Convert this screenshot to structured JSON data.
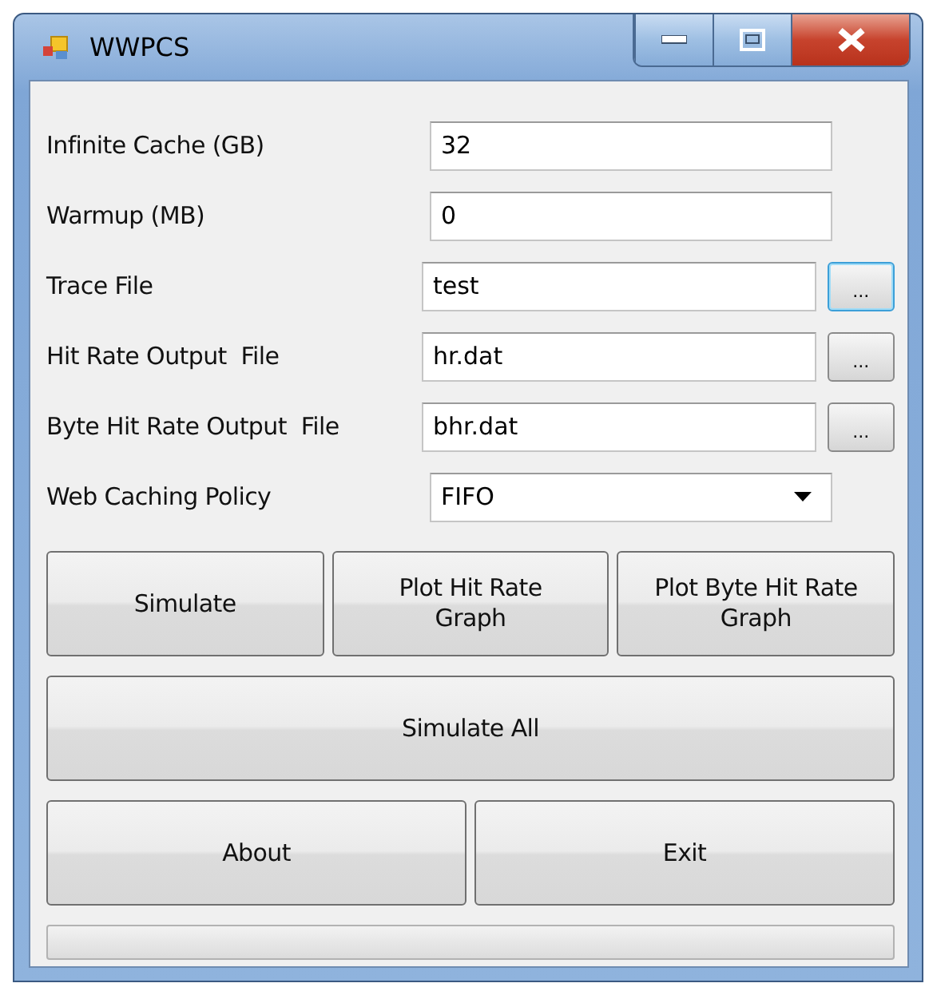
{
  "window": {
    "title": "WWPCS"
  },
  "fields": [
    {
      "kind": "text",
      "label": "Infinite Cache (GB)",
      "value": "32"
    },
    {
      "kind": "text",
      "label": "Warmup (MB)",
      "value": "0"
    },
    {
      "kind": "file",
      "label": "Trace File",
      "value": "test",
      "browse": "...",
      "focused": true
    },
    {
      "kind": "file",
      "label": "Hit Rate Output  File",
      "value": "hr.dat",
      "browse": "...",
      "focused": false
    },
    {
      "kind": "file",
      "label": "Byte Hit Rate Output  File",
      "value": "bhr.dat",
      "browse": "...",
      "focused": false
    },
    {
      "kind": "dropdown",
      "label": "Web Caching Policy",
      "value": "FIFO"
    }
  ],
  "button_rows": [
    [
      "Simulate",
      "Plot Hit Rate Graph",
      "Plot Byte Hit Rate Graph"
    ],
    [
      "Simulate All"
    ],
    [
      "About",
      "Exit"
    ]
  ],
  "progress": {
    "level": 0
  }
}
